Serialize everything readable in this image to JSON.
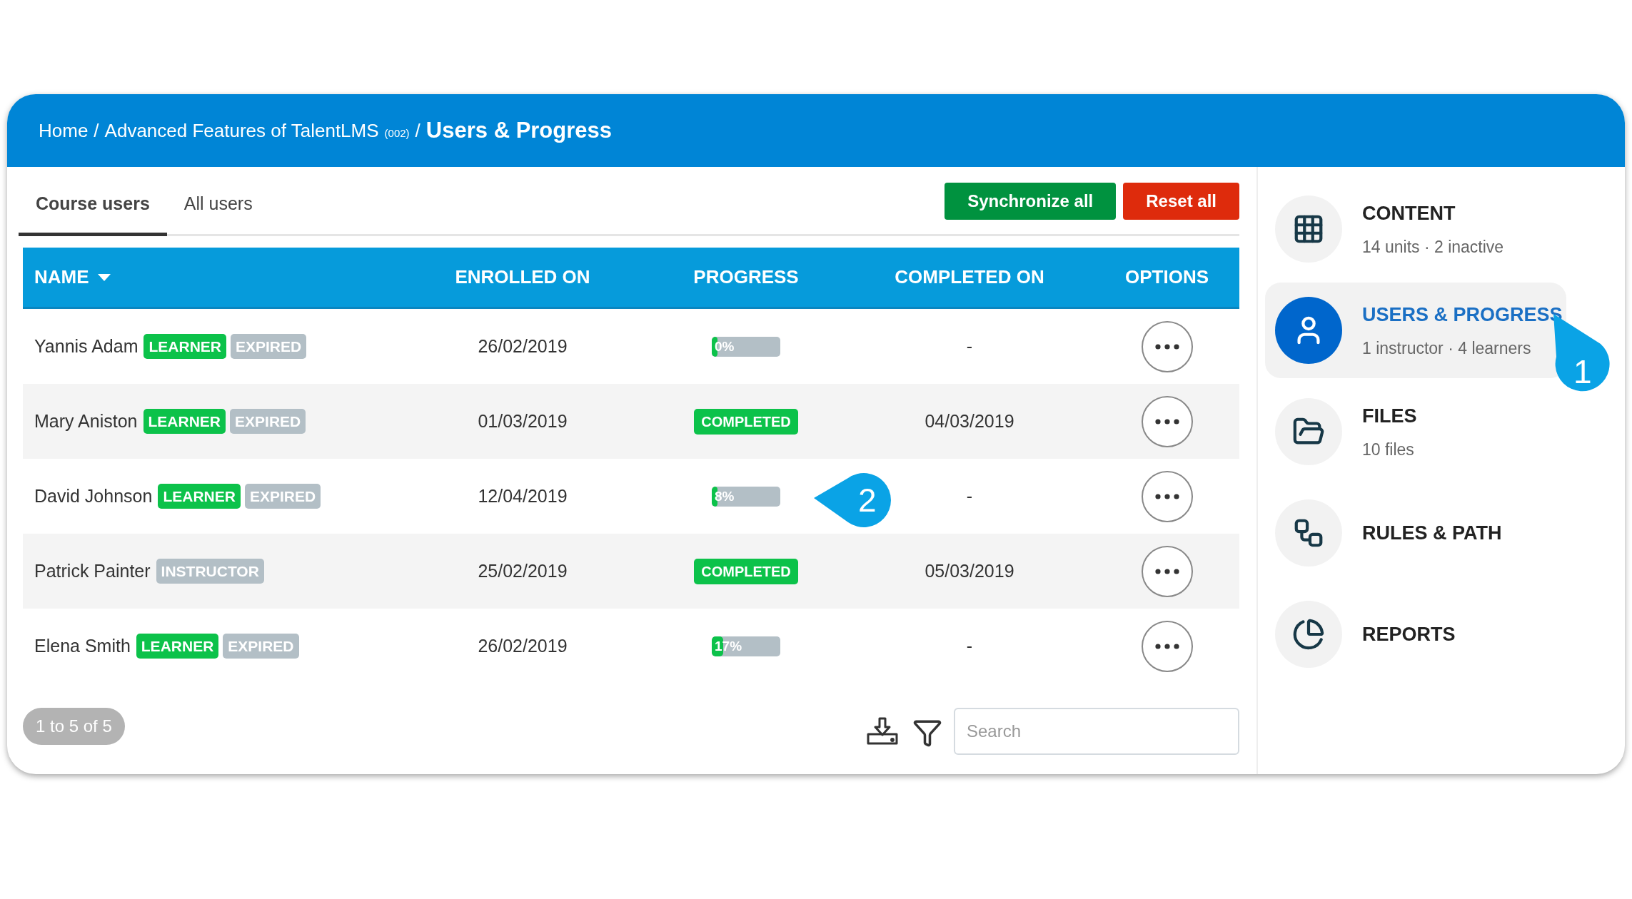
{
  "breadcrumb": {
    "items": [
      "Home",
      "Advanced Features of TalentLMS"
    ],
    "code": "(002)",
    "separator": "/",
    "current": "Users & Progress"
  },
  "tabs": [
    {
      "label": "Course users",
      "selected": true
    },
    {
      "label": "All users",
      "selected": false
    }
  ],
  "actions": [
    {
      "label": "Synchronize all",
      "color": "#00923f"
    },
    {
      "label": "Reset all",
      "color": "#de2b0c"
    }
  ],
  "table": {
    "columns": [
      {
        "label": "NAME",
        "sorted": true
      },
      {
        "label": "ENROLLED ON",
        "sorted": false
      },
      {
        "label": "PROGRESS",
        "sorted": false
      },
      {
        "label": "COMPLETED ON",
        "sorted": false
      },
      {
        "label": "OPTIONS",
        "sorted": false
      }
    ],
    "rows": [
      {
        "name": "Yannis Adam",
        "tags": [
          {
            "label": "LEARNER",
            "color": "#0cc24a"
          },
          {
            "label": "EXPIRED",
            "color": "#b3bfc6"
          }
        ],
        "enrolled": "26/02/2019",
        "progress": {
          "kind": "bar",
          "level": 0,
          "reading": "0%"
        },
        "completed": "-"
      },
      {
        "name": "Mary Aniston",
        "tags": [
          {
            "label": "LEARNER",
            "color": "#0cc24a"
          },
          {
            "label": "EXPIRED",
            "color": "#b3bfc6"
          }
        ],
        "enrolled": "01/03/2019",
        "progress": {
          "kind": "badge",
          "label": "COMPLETED"
        },
        "completed": "04/03/2019"
      },
      {
        "name": "David Johnson",
        "tags": [
          {
            "label": "LEARNER",
            "color": "#0cc24a"
          },
          {
            "label": "EXPIRED",
            "color": "#b3bfc6"
          }
        ],
        "enrolled": "12/04/2019",
        "progress": {
          "kind": "bar",
          "level": 0.08,
          "reading": "8%"
        },
        "completed": "-"
      },
      {
        "name": "Patrick Painter",
        "tags": [
          {
            "label": "INSTRUCTOR",
            "color": "#b3bfc6"
          }
        ],
        "enrolled": "25/02/2019",
        "progress": {
          "kind": "badge",
          "label": "COMPLETED"
        },
        "completed": "05/03/2019"
      },
      {
        "name": "Elena Smith",
        "tags": [
          {
            "label": "LEARNER",
            "color": "#0cc24a"
          },
          {
            "label": "EXPIRED",
            "color": "#b3bfc6"
          }
        ],
        "enrolled": "26/02/2019",
        "progress": {
          "kind": "bar",
          "level": 0.17,
          "reading": "17%"
        },
        "completed": "-"
      }
    ]
  },
  "footer": {
    "count": "1 to 5 of 5",
    "search": {
      "placeholder": "Search"
    }
  },
  "sidebar": {
    "items": [
      {
        "kind": "grid",
        "title": "CONTENT",
        "subtitle": "14 units · 2 inactive",
        "selected": false
      },
      {
        "kind": "user",
        "title": "USERS & PROGRESS",
        "subtitle": "1 instructor · 4 learners",
        "selected": true
      },
      {
        "kind": "folder",
        "title": "FILES",
        "subtitle": "10 files",
        "selected": false
      },
      {
        "kind": "path",
        "title": "RULES & PATH",
        "selected": false
      },
      {
        "kind": "pie",
        "title": "REPORTS",
        "selected": false
      }
    ]
  },
  "callouts": [
    {
      "label": "1"
    },
    {
      "label": "2"
    }
  ]
}
